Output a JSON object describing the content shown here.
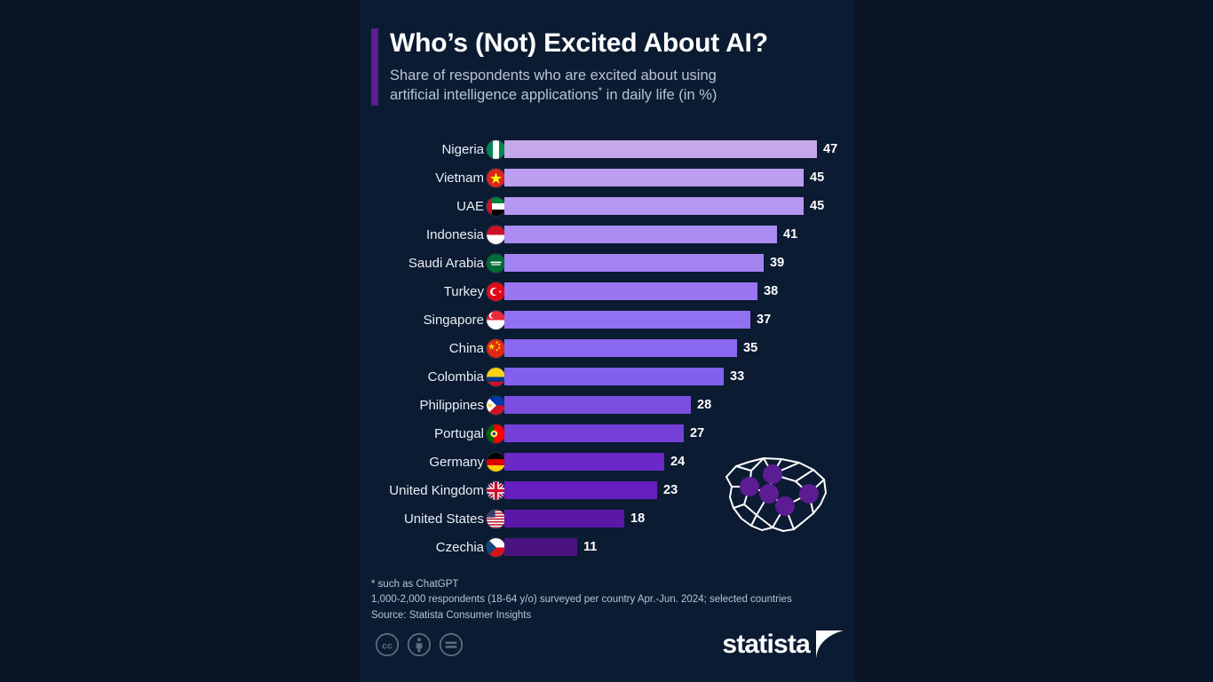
{
  "header": {
    "title": "Who’s (Not) Excited About AI?",
    "subtitle_line1": "Share of respondents who are excited about using",
    "subtitle_line2_a": "artificial intelligence applications",
    "subtitle_asterisk": "*",
    "subtitle_line2_b": " in daily life (in %)"
  },
  "footnotes": {
    "line1": "* such as ChatGPT",
    "line2": "1,000‑2,000 respondents (18‑64 y/o) surveyed per country Apr.‑Jun. 2024; selected countries",
    "line3": "Source: Statista Consumer Insights"
  },
  "branding": {
    "logo_text": "statista",
    "cc_icons": [
      "creative-commons-icon",
      "attribution-icon",
      "no-derivatives-icon"
    ]
  },
  "colors": {
    "page_background": "#091527",
    "card_background": "#0b1b32",
    "accent": "#5b1d91",
    "title_text": "#ffffff",
    "subtitle_text": "#b9c4d4",
    "value_text": "#ffffff",
    "bar_lightest": "#c5a8e8",
    "bar_darkest": "#4a1380"
  },
  "chart_data": {
    "type": "bar",
    "orientation": "horizontal",
    "title": "Who’s (Not) Excited About AI?",
    "subtitle": "Share of respondents who are excited about using artificial intelligence applications* in daily life (in %)",
    "xlabel": "",
    "ylabel": "",
    "unit": "%",
    "xlim": [
      0,
      47
    ],
    "grid": false,
    "legend": null,
    "categories": [
      "Nigeria",
      "Vietnam",
      "UAE",
      "Indonesia",
      "Saudi Arabia",
      "Turkey",
      "Singapore",
      "China",
      "Colombia",
      "Philippines",
      "Portugal",
      "Germany",
      "United Kingdom",
      "United States",
      "Czechia"
    ],
    "values": [
      47,
      45,
      45,
      41,
      39,
      38,
      37,
      35,
      33,
      28,
      27,
      24,
      23,
      18,
      11
    ],
    "bars": [
      {
        "label": "Nigeria",
        "value": 47,
        "value_text": "47",
        "flag": "flag-nigeria",
        "color": "#c5a8e8"
      },
      {
        "label": "Vietnam",
        "value": 45,
        "value_text": "45",
        "flag": "flag-vietnam",
        "color": "#bb9ef0"
      },
      {
        "label": "UAE",
        "value": 45,
        "value_text": "45",
        "flag": "flag-uae",
        "color": "#b596f0"
      },
      {
        "label": "Indonesia",
        "value": 41,
        "value_text": "41",
        "flag": "flag-indonesia",
        "color": "#ab8cf2"
      },
      {
        "label": "Saudi Arabia",
        "value": 39,
        "value_text": "39",
        "flag": "flag-saudi-arabia",
        "color": "#a382f2"
      },
      {
        "label": "Turkey",
        "value": 38,
        "value_text": "38",
        "flag": "flag-turkey",
        "color": "#9a76f2"
      },
      {
        "label": "Singapore",
        "value": 37,
        "value_text": "37",
        "flag": "flag-singapore",
        "color": "#9270f2"
      },
      {
        "label": "China",
        "value": 35,
        "value_text": "35",
        "flag": "flag-china",
        "color": "#8a68f0"
      },
      {
        "label": "Colombia",
        "value": 33,
        "value_text": "33",
        "flag": "flag-colombia",
        "color": "#8260ee"
      },
      {
        "label": "Philippines",
        "value": 28,
        "value_text": "28",
        "flag": "flag-philippines",
        "color": "#7a4fe0"
      },
      {
        "label": "Portugal",
        "value": 27,
        "value_text": "27",
        "flag": "flag-portugal",
        "color": "#7440d8"
      },
      {
        "label": "Germany",
        "value": 24,
        "value_text": "24",
        "flag": "flag-germany",
        "color": "#6d28c8"
      },
      {
        "label": "United Kingdom",
        "value": 23,
        "value_text": "23",
        "flag": "flag-united-kingdom",
        "color": "#661fbe"
      },
      {
        "label": "United States",
        "value": 18,
        "value_text": "18",
        "flag": "flag-united-states",
        "color": "#5a17a8"
      },
      {
        "label": "Czechia",
        "value": 11,
        "value_text": "11",
        "flag": "flag-czechia",
        "color": "#4a1380"
      }
    ]
  }
}
